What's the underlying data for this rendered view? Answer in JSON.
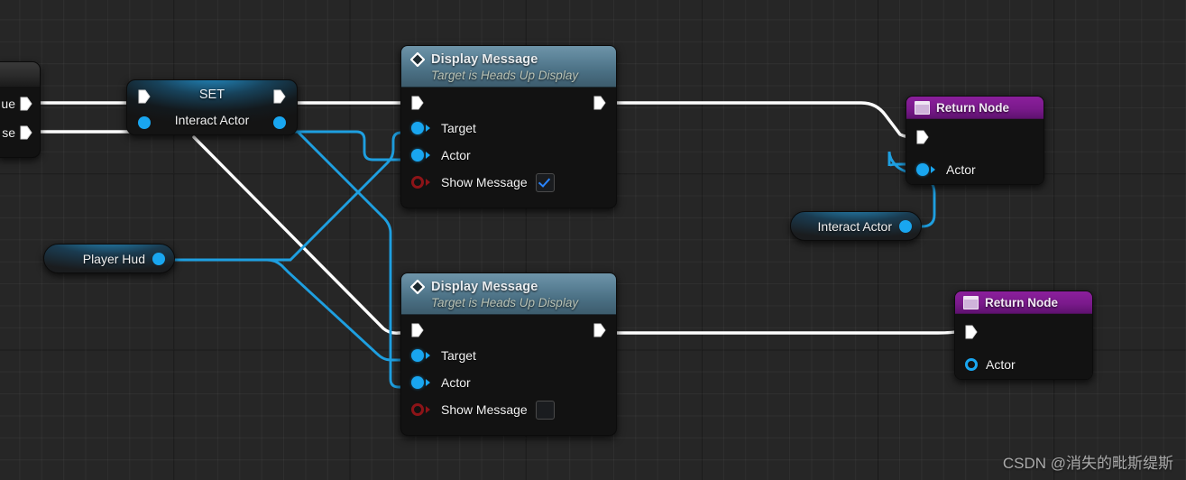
{
  "canvas": {
    "background_color": "#262626",
    "grid_minor_color": "#2f2f2f",
    "grid_major_color": "#111111"
  },
  "watermark": {
    "text": "CSDN @消失的毗斯缇斯"
  },
  "colors": {
    "exec_wire": "#ffffff",
    "object_wire": "#1e9fe0",
    "object_pin": "#19a6f0",
    "bool_pin": "#8d1418",
    "function_header_start": "#6e94a8",
    "function_header_end": "#3c5b6c",
    "return_header": "#7b1a8c",
    "set_header_glow": "#2496d4",
    "checkbox_check": "#2a85ff"
  },
  "nodes": {
    "branch_partial": {
      "name": "branch-node-partial",
      "pins": [
        {
          "label": "ue",
          "type": "exec"
        },
        {
          "label": "se",
          "type": "exec"
        }
      ]
    },
    "set_node": {
      "title": "SET",
      "variable_label": "Interact Actor",
      "exec_in": "exec-in",
      "exec_out": "exec-out",
      "data_in": "interact-actor-in",
      "data_out": "interact-actor-out"
    },
    "display_message_top": {
      "title": "Display Message",
      "subtitle": "Target is Heads Up Display",
      "icon": "diamond-function-icon",
      "pins": [
        {
          "label": "Target",
          "type": "object",
          "connected": true
        },
        {
          "label": "Actor",
          "type": "object",
          "connected": true
        },
        {
          "label": "Show Message",
          "type": "bool",
          "connected": false,
          "checkbox": true,
          "checked": true
        }
      ]
    },
    "display_message_bottom": {
      "title": "Display Message",
      "subtitle": "Target is Heads Up Display",
      "icon": "diamond-function-icon",
      "pins": [
        {
          "label": "Target",
          "type": "object",
          "connected": true
        },
        {
          "label": "Actor",
          "type": "object",
          "connected": true
        },
        {
          "label": "Show Message",
          "type": "bool",
          "connected": false,
          "checkbox": true,
          "checked": false
        }
      ]
    },
    "return_node_top": {
      "title": "Return Node",
      "icon": "return-node-icon",
      "pins": [
        {
          "label": "Actor",
          "type": "object",
          "connected": true
        }
      ]
    },
    "return_node_bottom": {
      "title": "Return Node",
      "icon": "return-node-icon",
      "pins": [
        {
          "label": "Actor",
          "type": "object",
          "connected": false
        }
      ]
    },
    "player_hud_var": {
      "label": "Player Hud",
      "pin": "object-out"
    },
    "interact_actor_var": {
      "label": "Interact Actor",
      "pin": "object-out"
    }
  }
}
